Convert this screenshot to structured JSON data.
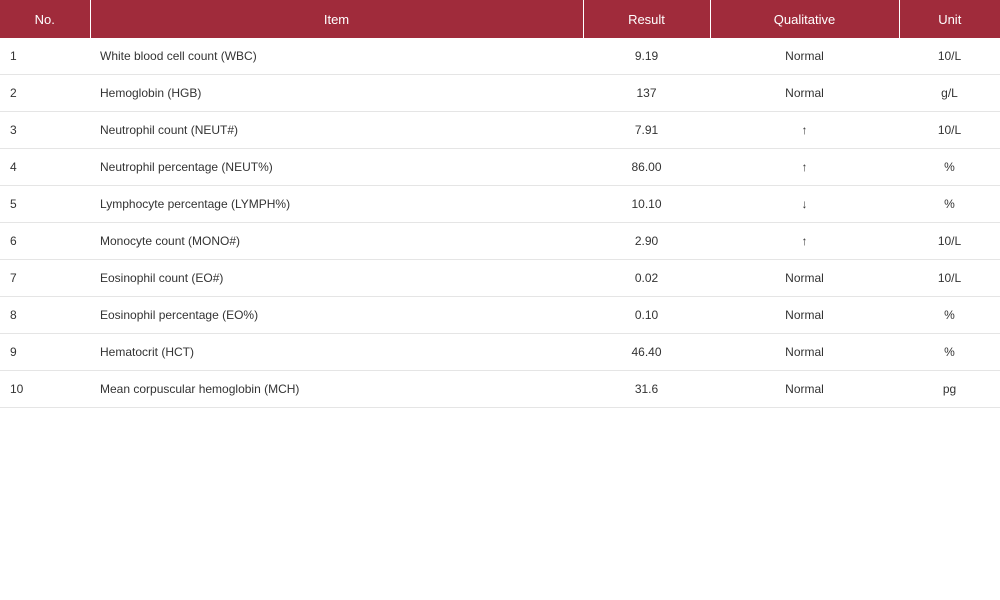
{
  "table": {
    "headers": {
      "no": "No.",
      "item": "Item",
      "result": "Result",
      "qualitative": "Qualitative",
      "unit": "Unit"
    },
    "rows": [
      {
        "no": "1",
        "item": "White blood cell count (WBC)",
        "result": "9.19",
        "qualitative": "Normal",
        "unit": "10/L"
      },
      {
        "no": "2",
        "item": "Hemoglobin (HGB)",
        "result": "137",
        "qualitative": "Normal",
        "unit": "g/L"
      },
      {
        "no": "3",
        "item": "Neutrophil count (NEUT#)",
        "result": "7.91",
        "qualitative": "↑",
        "unit": "10/L"
      },
      {
        "no": "4",
        "item": "Neutrophil percentage (NEUT%)",
        "result": "86.00",
        "qualitative": "↑",
        "unit": "%"
      },
      {
        "no": "5",
        "item": "Lymphocyte percentage (LYMPH%)",
        "result": "10.10",
        "qualitative": "↓",
        "unit": "%"
      },
      {
        "no": "6",
        "item": "Monocyte count (MONO#)",
        "result": "2.90",
        "qualitative": "↑",
        "unit": "10/L"
      },
      {
        "no": "7",
        "item": "Eosinophil count (EO#)",
        "result": "0.02",
        "qualitative": "Normal",
        "unit": "10/L"
      },
      {
        "no": "8",
        "item": "Eosinophil percentage (EO%)",
        "result": "0.10",
        "qualitative": "Normal",
        "unit": "%"
      },
      {
        "no": "9",
        "item": "Hematocrit (HCT)",
        "result": "46.40",
        "qualitative": "Normal",
        "unit": "%"
      },
      {
        "no": "10",
        "item": "Mean corpuscular hemoglobin (MCH)",
        "result": "31.6",
        "qualitative": "Normal",
        "unit": "pg"
      }
    ]
  },
  "colors": {
    "header_bg": "#a02b3b",
    "header_text": "#ffffff",
    "row_border": "#e5e5e5"
  }
}
